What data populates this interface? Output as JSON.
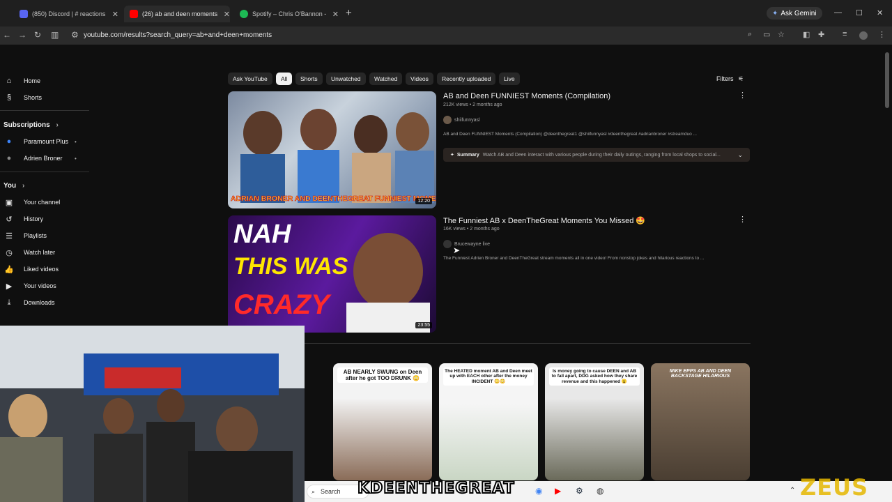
{
  "browser": {
    "tabs": [
      {
        "title": "(850) Discord | # reactions",
        "color": "#5865f2"
      },
      {
        "title": "(26) ab and deen moments",
        "color": "#ff0000"
      },
      {
        "title": "Spotify – Chris O'Bannon - Disc",
        "color": "#1db954"
      }
    ],
    "new_tab": "+",
    "gemini": "Ask Gemini",
    "url": "youtube.com/results?search_query=ab+and+deen+moments"
  },
  "sidebar": {
    "home": "Home",
    "shorts": "Shorts",
    "subscriptions": "Subscriptions",
    "subs": [
      "Paramount Plus",
      "Adrien Broner"
    ],
    "you": "You",
    "you_items": [
      "Your channel",
      "History",
      "Playlists",
      "Watch later",
      "Liked videos",
      "Your videos",
      "Downloads"
    ]
  },
  "chips": [
    "Ask YouTube",
    "All",
    "Shorts",
    "Unwatched",
    "Watched",
    "Videos",
    "Recently uploaded",
    "Live"
  ],
  "filters": "Filters",
  "results": [
    {
      "title": "AB and Deen FUNNIEST Moments (Compilation)",
      "meta": "212K views • 2 months ago",
      "channel": "shiifunnyasl",
      "desc": "AB and Deen FUNNIEST Moments (Compilation) @deenthegreat1 @shiifunnyasl #deenthegreat #adrianbroner #streamduo ...",
      "duration": "12:20",
      "thumb_text": "ADRIAN BRONER AND DEENTHEGREAT FUNNIEST MOMENTS",
      "summary_label": "Summary",
      "summary": "Watch AB and Deen interact with various people during their daily outings, ranging from local shops to social..."
    },
    {
      "title": "The Funniest AB x DeenTheGreat Moments You Missed 🤩",
      "meta": "16K views • 2 months ago",
      "channel": "Brucewayne live",
      "desc": "The Funniest Adrien Broner and DeenTheGreat stream moments all in one video! From nonstop jokes and hilarious reactions to ...",
      "duration": "23:55",
      "thumb_lines": [
        "NAH",
        "THIS WAS",
        "CRAZY"
      ]
    }
  ],
  "shorts": [
    {
      "caption": "AB NEARLY SWUNG on Deen after he got TOO DRUNK 😳"
    },
    {
      "caption": "The HEATED moment AB and Deen meet up with EACH other after the money INCIDENT 😳😳"
    },
    {
      "caption": "Is money going to cause DEEN and AB to fall apart, DDG asked how they share revenue and this happened 😮"
    },
    {
      "caption": "MIKE EPPS AB AND DEEN BACKSTAGE HILARIOUS"
    }
  ],
  "taskbar": {
    "search": "Search"
  },
  "overlay_text": "KDEENTHEGREAT",
  "brand_text": "ZEUS"
}
